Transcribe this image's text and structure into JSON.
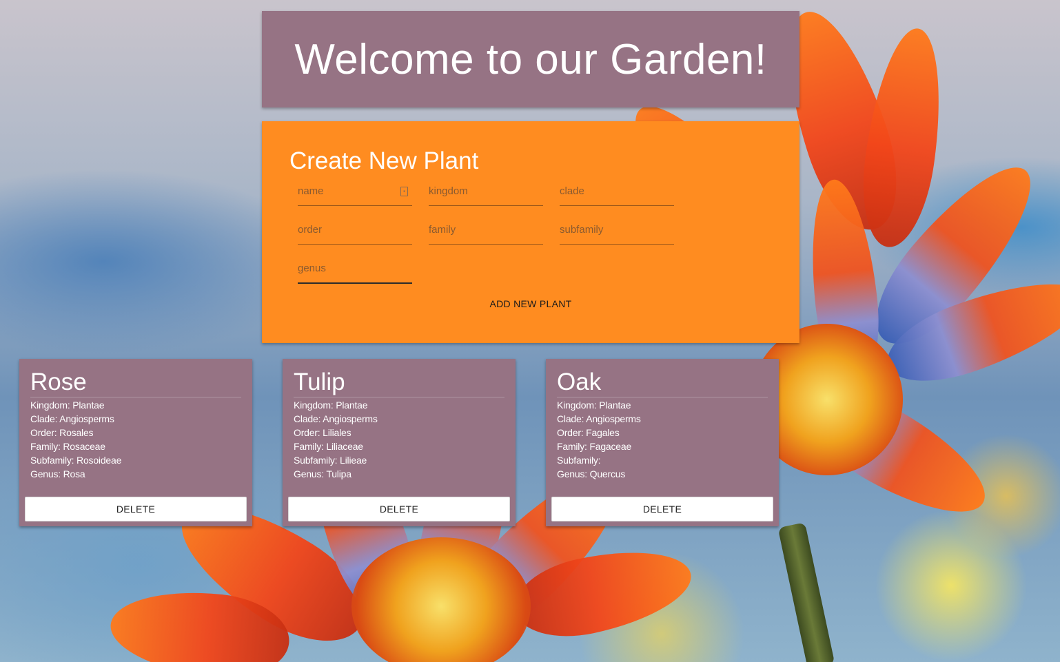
{
  "header": {
    "title": "Welcome to our Garden!"
  },
  "form": {
    "title": "Create New Plant",
    "fields": [
      {
        "id": "name",
        "placeholder": "name",
        "value": ""
      },
      {
        "id": "kingdom",
        "placeholder": "kingdom",
        "value": ""
      },
      {
        "id": "clade",
        "placeholder": "clade",
        "value": ""
      },
      {
        "id": "order",
        "placeholder": "order",
        "value": ""
      },
      {
        "id": "family",
        "placeholder": "family",
        "value": ""
      },
      {
        "id": "subfamily",
        "placeholder": "subfamily",
        "value": ""
      },
      {
        "id": "genus",
        "placeholder": "genus",
        "value": ""
      }
    ],
    "submit_label": "ADD NEW PLANT"
  },
  "plants": [
    {
      "name": "Rose",
      "kingdom": "Kingdom: Plantae",
      "clade": "Clade: Angiosperms",
      "order": "Order: Rosales",
      "family": "Family: Rosaceae",
      "subfamily": "Subfamily: Rosoideae",
      "genus": "Genus: Rosa",
      "delete_label": "DELETE"
    },
    {
      "name": "Tulip",
      "kingdom": "Kingdom: Plantae",
      "clade": "Clade: Angiosperms",
      "order": "Order: Liliales",
      "family": "Family: Liliaceae",
      "subfamily": "Subfamily: Lilieae",
      "genus": "Genus: Tulipa",
      "delete_label": "DELETE"
    },
    {
      "name": "Oak",
      "kingdom": "Kingdom: Plantae",
      "clade": "Clade: Angiosperms",
      "order": "Order: Fagales",
      "family": "Family: Fagaceae",
      "subfamily": "Subfamily:",
      "genus": "Genus: Quercus",
      "delete_label": "DELETE"
    }
  ],
  "theme": {
    "card_color": "#967384",
    "form_color": "#ff8c20",
    "text_color": "#ffffff"
  }
}
